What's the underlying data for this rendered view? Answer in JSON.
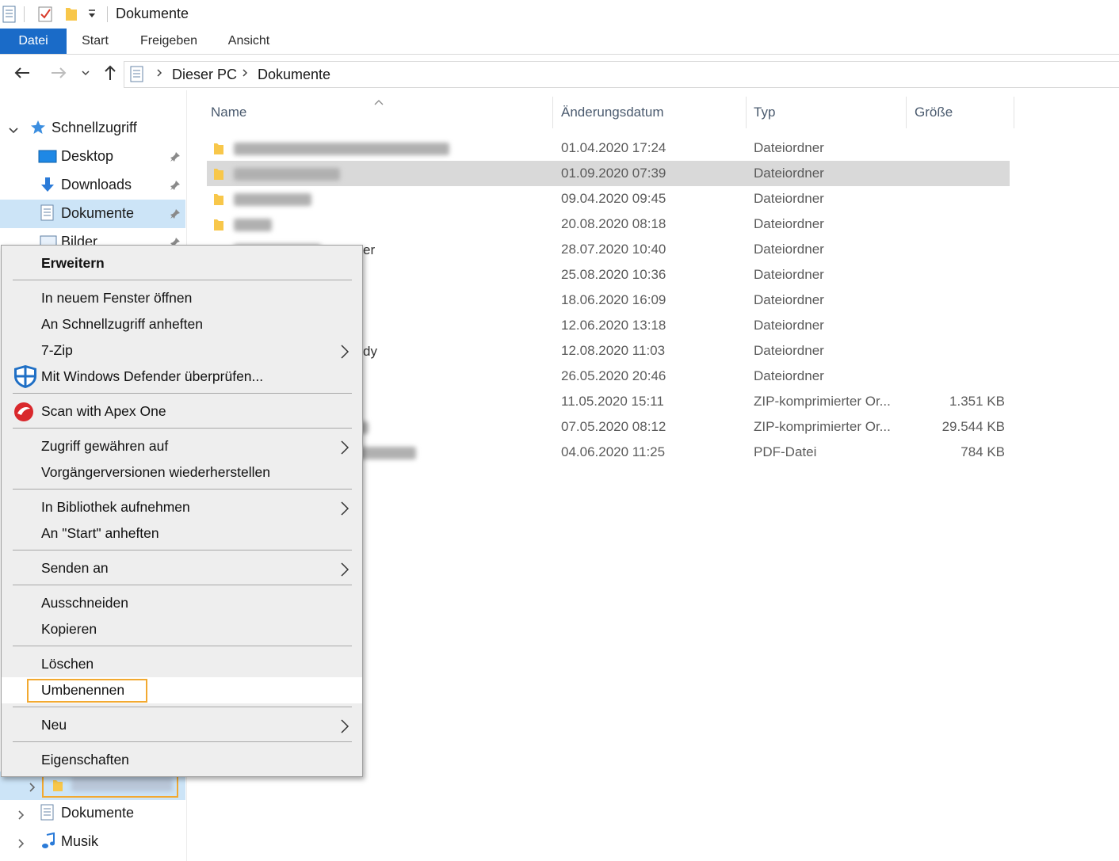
{
  "window": {
    "title": "Dokumente"
  },
  "ribbon": {
    "tabs": [
      {
        "label": "Datei",
        "active": true
      },
      {
        "label": "Start"
      },
      {
        "label": "Freigeben"
      },
      {
        "label": "Ansicht"
      }
    ]
  },
  "address": {
    "breadcrumbs": [
      "Dieser PC",
      "Dokumente"
    ]
  },
  "navpane": {
    "quick_access": {
      "label": "Schnellzugriff",
      "items": [
        {
          "label": "Desktop",
          "icon": "desktop-icon"
        },
        {
          "label": "Downloads",
          "icon": "download-arrow-icon"
        },
        {
          "label": "Dokumente",
          "icon": "documents-icon",
          "selected": true
        },
        {
          "label": "Bilder",
          "icon": "pictures-icon"
        }
      ]
    },
    "tree_bottom": [
      {
        "label": "Dokumente",
        "icon": "documents-icon"
      },
      {
        "label": "Musik",
        "icon": "music-icon"
      }
    ]
  },
  "filelist": {
    "columns": {
      "name": "Name",
      "date": "Änderungsdatum",
      "type": "Typ",
      "size": "Größe"
    },
    "rows": [
      {
        "date": "01.04.2020 17:24",
        "type": "Dateiordner",
        "size": ""
      },
      {
        "date": "01.09.2020 07:39",
        "type": "Dateiordner",
        "size": "",
        "selected": true
      },
      {
        "date": "09.04.2020 09:45",
        "type": "Dateiordner",
        "size": ""
      },
      {
        "date": "20.08.2020 08:18",
        "type": "Dateiordner",
        "size": ""
      },
      {
        "date": "28.07.2020 10:40",
        "type": "Dateiordner",
        "size": ""
      },
      {
        "date": "25.08.2020 10:36",
        "type": "Dateiordner",
        "size": ""
      },
      {
        "date": "18.06.2020 16:09",
        "type": "Dateiordner",
        "size": ""
      },
      {
        "date": "12.06.2020 13:18",
        "type": "Dateiordner",
        "size": ""
      },
      {
        "date": "12.08.2020 11:03",
        "type": "Dateiordner",
        "size": ""
      },
      {
        "date": "26.05.2020 20:46",
        "type": "Dateiordner",
        "size": ""
      },
      {
        "date": "11.05.2020 15:11",
        "type": "ZIP-komprimierter Or...",
        "size": "1.351 KB"
      },
      {
        "date": "07.05.2020 08:12",
        "type": "ZIP-komprimierter Or...",
        "size": "29.544 KB"
      },
      {
        "date": "04.06.2020 11:25",
        "type": "PDF-Datei",
        "size": "784 KB"
      }
    ],
    "partial_name_fragments": [
      "er",
      "dy"
    ]
  },
  "context_menu": {
    "items": [
      {
        "label": "Erweitern",
        "bold": true
      },
      {
        "label": "In neuem Fenster öffnen"
      },
      {
        "label": "An Schnellzugriff anheften"
      },
      {
        "label": "7-Zip",
        "submenu": true
      },
      {
        "label": "Mit Windows Defender überprüfen...",
        "icon": "windows-defender-shield-icon"
      },
      {
        "label": "Scan with Apex One",
        "icon": "apex-one-icon"
      },
      {
        "label": "Zugriff gewähren auf",
        "submenu": true
      },
      {
        "label": "Vorgängerversionen wiederherstellen"
      },
      {
        "label": "In Bibliothek aufnehmen",
        "submenu": true
      },
      {
        "label": "An \"Start\" anheften"
      },
      {
        "label": "Senden an",
        "submenu": true
      },
      {
        "label": "Ausschneiden"
      },
      {
        "label": "Kopieren"
      },
      {
        "label": "Löschen"
      },
      {
        "label": "Umbenennen",
        "highlighted": true
      },
      {
        "label": "Neu",
        "submenu": true
      },
      {
        "label": "Eigenschaften"
      }
    ]
  },
  "colors": {
    "accent": "#1a6bc8",
    "selection": "#cce4f7",
    "highlight_box": "#f2a930"
  }
}
